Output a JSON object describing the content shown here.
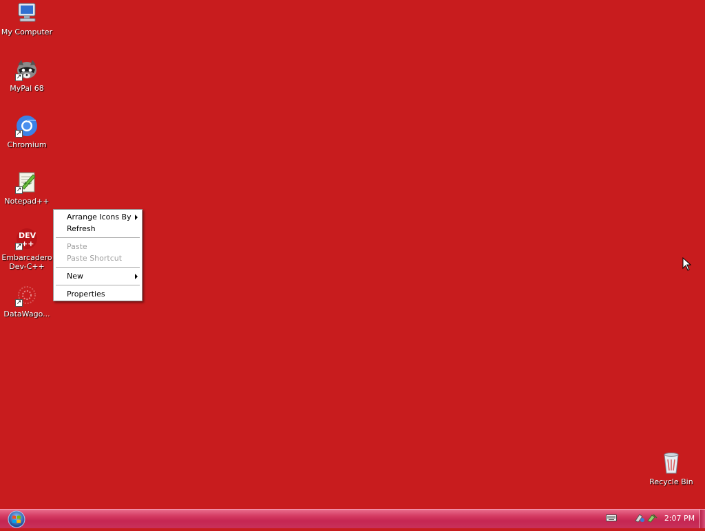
{
  "desktop": {
    "background_color": "#c81c1e",
    "icons": [
      {
        "label": "My Computer",
        "icon": "computer-icon",
        "shortcut": false
      },
      {
        "label": "MyPal 68",
        "icon": "raccoon-browser-icon",
        "shortcut": true
      },
      {
        "label": "Chromium",
        "icon": "chromium-icon",
        "shortcut": true
      },
      {
        "label": "Notepad++",
        "icon": "notepadpp-icon",
        "shortcut": true
      },
      {
        "label": "Embarcadero Dev-C++",
        "icon": "devcpp-icon",
        "shortcut": true
      },
      {
        "label": "DataWago...",
        "icon": "datawagon-icon",
        "shortcut": true
      }
    ],
    "recycle_bin": {
      "label": "Recycle Bin",
      "icon": "recycle-bin-icon"
    }
  },
  "context_menu": {
    "items": [
      {
        "label": "Arrange Icons By",
        "enabled": true,
        "submenu": true
      },
      {
        "label": "Refresh",
        "enabled": true,
        "submenu": false
      },
      {
        "label": "Paste",
        "enabled": false,
        "submenu": false
      },
      {
        "label": "Paste Shortcut",
        "enabled": false,
        "submenu": false
      },
      {
        "label": "New",
        "enabled": true,
        "submenu": true
      },
      {
        "label": "Properties",
        "enabled": true,
        "submenu": false
      }
    ]
  },
  "taskbar": {
    "start_icon": "windows-orb-icon",
    "tray_icons": [
      "keyboard-icon",
      "network-icon",
      "safely-remove-icon"
    ],
    "clock": "2:07 PM",
    "accent_color": "#d43a62"
  }
}
